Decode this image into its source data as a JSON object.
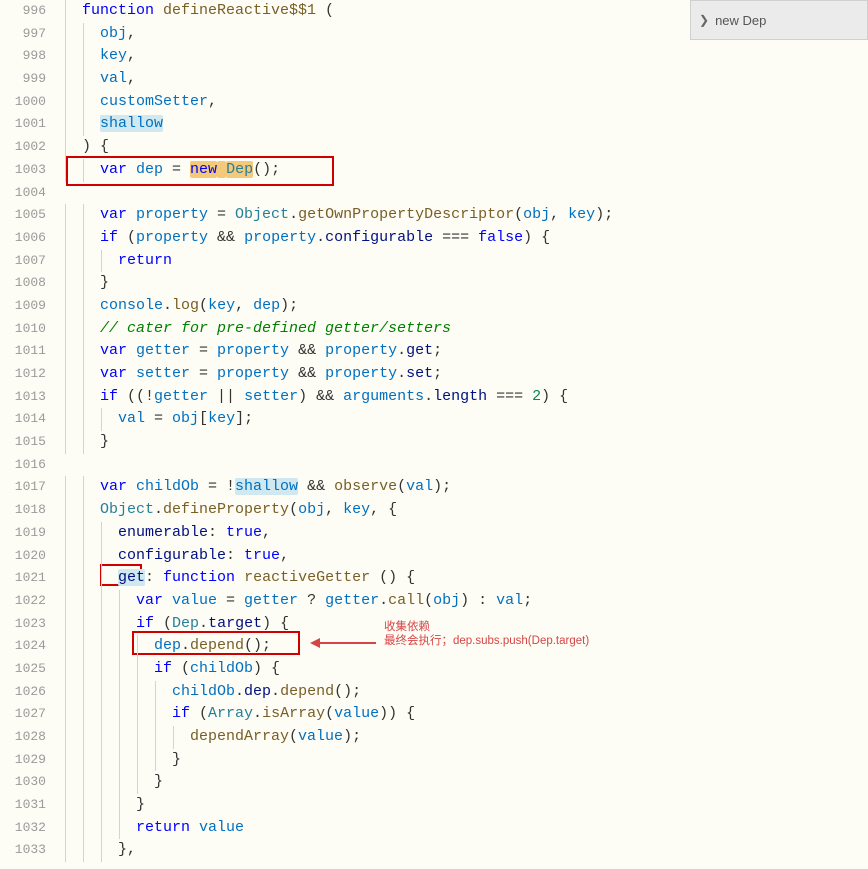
{
  "outline": {
    "label": "new Dep"
  },
  "annotation": {
    "line1": "收集依赖",
    "line2": "最终会执行；dep.subs.push(Dep.target)"
  },
  "lines": [
    {
      "num": 996,
      "ind": 1,
      "tokens": [
        {
          "t": "function ",
          "c": "k-blue"
        },
        {
          "t": "defineReactive$$1",
          "c": "k-call"
        },
        {
          "t": " (",
          "c": ""
        }
      ]
    },
    {
      "num": 997,
      "ind": 2,
      "tokens": [
        {
          "t": "obj",
          "c": "k-var"
        },
        {
          "t": ",",
          "c": ""
        }
      ]
    },
    {
      "num": 998,
      "ind": 2,
      "tokens": [
        {
          "t": "key",
          "c": "k-var"
        },
        {
          "t": ",",
          "c": ""
        }
      ]
    },
    {
      "num": 999,
      "ind": 2,
      "tokens": [
        {
          "t": "val",
          "c": "k-var"
        },
        {
          "t": ",",
          "c": ""
        }
      ]
    },
    {
      "num": 1000,
      "ind": 2,
      "tokens": [
        {
          "t": "customSetter",
          "c": "k-var"
        },
        {
          "t": ",",
          "c": ""
        }
      ]
    },
    {
      "num": 1001,
      "ind": 2,
      "tokens": [
        {
          "t": "shallow",
          "c": "k-var",
          "hl": "hl-shallow"
        }
      ]
    },
    {
      "num": 1002,
      "ind": 1,
      "tokens": [
        {
          "t": ") {",
          "c": ""
        }
      ]
    },
    {
      "num": 1003,
      "ind": 2,
      "tokens": [
        {
          "t": "var ",
          "c": "k-blue"
        },
        {
          "t": "dep",
          "c": "k-var"
        },
        {
          "t": " = ",
          "c": ""
        },
        {
          "t": "new",
          "c": "k-blue",
          "hl": "hl-newdep"
        },
        {
          "t": " ",
          "c": "",
          "hl": "hl-newdep"
        },
        {
          "t": "Dep",
          "c": "k-func",
          "hl": "hl-newdep"
        },
        {
          "t": "();",
          "c": ""
        }
      ]
    },
    {
      "num": 1004,
      "ind": 0,
      "tokens": []
    },
    {
      "num": 1005,
      "ind": 2,
      "tokens": [
        {
          "t": "var ",
          "c": "k-blue"
        },
        {
          "t": "property",
          "c": "k-var"
        },
        {
          "t": " = ",
          "c": ""
        },
        {
          "t": "Object",
          "c": "k-func"
        },
        {
          "t": ".",
          "c": ""
        },
        {
          "t": "getOwnPropertyDescriptor",
          "c": "k-call"
        },
        {
          "t": "(",
          "c": ""
        },
        {
          "t": "obj",
          "c": "k-var"
        },
        {
          "t": ", ",
          "c": ""
        },
        {
          "t": "key",
          "c": "k-var"
        },
        {
          "t": ");",
          "c": ""
        }
      ]
    },
    {
      "num": 1006,
      "ind": 2,
      "tokens": [
        {
          "t": "if",
          "c": "k-blue"
        },
        {
          "t": " (",
          "c": ""
        },
        {
          "t": "property",
          "c": "k-var"
        },
        {
          "t": " && ",
          "c": ""
        },
        {
          "t": "property",
          "c": "k-var"
        },
        {
          "t": ".",
          "c": ""
        },
        {
          "t": "configurable",
          "c": "k-prop"
        },
        {
          "t": " === ",
          "c": ""
        },
        {
          "t": "false",
          "c": "k-const"
        },
        {
          "t": ") {",
          "c": ""
        }
      ]
    },
    {
      "num": 1007,
      "ind": 3,
      "tokens": [
        {
          "t": "return",
          "c": "k-blue"
        }
      ]
    },
    {
      "num": 1008,
      "ind": 2,
      "tokens": [
        {
          "t": "}",
          "c": ""
        }
      ]
    },
    {
      "num": 1009,
      "ind": 2,
      "tokens": [
        {
          "t": "console",
          "c": "k-var"
        },
        {
          "t": ".",
          "c": ""
        },
        {
          "t": "log",
          "c": "k-call"
        },
        {
          "t": "(",
          "c": ""
        },
        {
          "t": "key",
          "c": "k-var"
        },
        {
          "t": ", ",
          "c": ""
        },
        {
          "t": "dep",
          "c": "k-var"
        },
        {
          "t": ");",
          "c": ""
        }
      ]
    },
    {
      "num": 1010,
      "ind": 2,
      "tokens": [
        {
          "t": "// cater for pre-defined getter/setters",
          "c": "k-comment"
        }
      ]
    },
    {
      "num": 1011,
      "ind": 2,
      "tokens": [
        {
          "t": "var ",
          "c": "k-blue"
        },
        {
          "t": "getter",
          "c": "k-var"
        },
        {
          "t": " = ",
          "c": ""
        },
        {
          "t": "property",
          "c": "k-var"
        },
        {
          "t": " && ",
          "c": ""
        },
        {
          "t": "property",
          "c": "k-var"
        },
        {
          "t": ".",
          "c": ""
        },
        {
          "t": "get",
          "c": "k-prop"
        },
        {
          "t": ";",
          "c": ""
        }
      ]
    },
    {
      "num": 1012,
      "ind": 2,
      "tokens": [
        {
          "t": "var ",
          "c": "k-blue"
        },
        {
          "t": "setter",
          "c": "k-var"
        },
        {
          "t": " = ",
          "c": ""
        },
        {
          "t": "property",
          "c": "k-var"
        },
        {
          "t": " && ",
          "c": ""
        },
        {
          "t": "property",
          "c": "k-var"
        },
        {
          "t": ".",
          "c": ""
        },
        {
          "t": "set",
          "c": "k-prop"
        },
        {
          "t": ";",
          "c": ""
        }
      ]
    },
    {
      "num": 1013,
      "ind": 2,
      "tokens": [
        {
          "t": "if",
          "c": "k-blue"
        },
        {
          "t": " ((!",
          "c": ""
        },
        {
          "t": "getter",
          "c": "k-var"
        },
        {
          "t": " || ",
          "c": ""
        },
        {
          "t": "setter",
          "c": "k-var"
        },
        {
          "t": ") && ",
          "c": ""
        },
        {
          "t": "arguments",
          "c": "k-var"
        },
        {
          "t": ".",
          "c": ""
        },
        {
          "t": "length",
          "c": "k-prop"
        },
        {
          "t": " === ",
          "c": ""
        },
        {
          "t": "2",
          "c": "k-num"
        },
        {
          "t": ") {",
          "c": ""
        }
      ]
    },
    {
      "num": 1014,
      "ind": 3,
      "tokens": [
        {
          "t": "val",
          "c": "k-var"
        },
        {
          "t": " = ",
          "c": ""
        },
        {
          "t": "obj",
          "c": "k-var"
        },
        {
          "t": "[",
          "c": ""
        },
        {
          "t": "key",
          "c": "k-var"
        },
        {
          "t": "];",
          "c": ""
        }
      ]
    },
    {
      "num": 1015,
      "ind": 2,
      "tokens": [
        {
          "t": "}",
          "c": ""
        }
      ]
    },
    {
      "num": 1016,
      "ind": 0,
      "tokens": []
    },
    {
      "num": 1017,
      "ind": 2,
      "tokens": [
        {
          "t": "var ",
          "c": "k-blue"
        },
        {
          "t": "childOb",
          "c": "k-var"
        },
        {
          "t": " = !",
          "c": ""
        },
        {
          "t": "shallow",
          "c": "k-var",
          "hl": "hl-shallow"
        },
        {
          "t": " && ",
          "c": ""
        },
        {
          "t": "observe",
          "c": "k-call"
        },
        {
          "t": "(",
          "c": ""
        },
        {
          "t": "val",
          "c": "k-var"
        },
        {
          "t": ");",
          "c": ""
        }
      ]
    },
    {
      "num": 1018,
      "ind": 2,
      "tokens": [
        {
          "t": "Object",
          "c": "k-func"
        },
        {
          "t": ".",
          "c": ""
        },
        {
          "t": "defineProperty",
          "c": "k-call"
        },
        {
          "t": "(",
          "c": ""
        },
        {
          "t": "obj",
          "c": "k-var"
        },
        {
          "t": ", ",
          "c": ""
        },
        {
          "t": "key",
          "c": "k-var"
        },
        {
          "t": ", {",
          "c": ""
        }
      ]
    },
    {
      "num": 1019,
      "ind": 3,
      "tokens": [
        {
          "t": "enumerable",
          "c": "k-prop"
        },
        {
          "t": ": ",
          "c": ""
        },
        {
          "t": "true",
          "c": "k-const"
        },
        {
          "t": ",",
          "c": ""
        }
      ]
    },
    {
      "num": 1020,
      "ind": 3,
      "tokens": [
        {
          "t": "configurable",
          "c": "k-prop"
        },
        {
          "t": ": ",
          "c": ""
        },
        {
          "t": "true",
          "c": "k-const"
        },
        {
          "t": ",",
          "c": ""
        }
      ]
    },
    {
      "num": 1021,
      "ind": 3,
      "tokens": [
        {
          "t": "get",
          "c": "k-prop",
          "hl": "hl-get"
        },
        {
          "t": ":",
          "c": ""
        },
        {
          "t": " ",
          "c": ""
        },
        {
          "t": "function ",
          "c": "k-blue"
        },
        {
          "t": "reactiveGetter",
          "c": "k-call"
        },
        {
          "t": " () {",
          "c": ""
        }
      ]
    },
    {
      "num": 1022,
      "ind": 4,
      "tokens": [
        {
          "t": "var ",
          "c": "k-blue"
        },
        {
          "t": "value",
          "c": "k-var"
        },
        {
          "t": " = ",
          "c": ""
        },
        {
          "t": "getter",
          "c": "k-var"
        },
        {
          "t": " ? ",
          "c": ""
        },
        {
          "t": "getter",
          "c": "k-var"
        },
        {
          "t": ".",
          "c": ""
        },
        {
          "t": "call",
          "c": "k-call"
        },
        {
          "t": "(",
          "c": ""
        },
        {
          "t": "obj",
          "c": "k-var"
        },
        {
          "t": ") : ",
          "c": ""
        },
        {
          "t": "val",
          "c": "k-var"
        },
        {
          "t": ";",
          "c": ""
        }
      ]
    },
    {
      "num": 1023,
      "ind": 4,
      "tokens": [
        {
          "t": "if",
          "c": "k-blue"
        },
        {
          "t": " (",
          "c": ""
        },
        {
          "t": "Dep",
          "c": "k-func"
        },
        {
          "t": ".",
          "c": ""
        },
        {
          "t": "target",
          "c": "k-prop"
        },
        {
          "t": ") {",
          "c": ""
        }
      ]
    },
    {
      "num": 1024,
      "ind": 5,
      "tokens": [
        {
          "t": "dep",
          "c": "k-var"
        },
        {
          "t": ".",
          "c": ""
        },
        {
          "t": "depend",
          "c": "k-call"
        },
        {
          "t": "();",
          "c": ""
        }
      ]
    },
    {
      "num": 1025,
      "ind": 5,
      "tokens": [
        {
          "t": "if",
          "c": "k-blue"
        },
        {
          "t": " (",
          "c": ""
        },
        {
          "t": "childOb",
          "c": "k-var"
        },
        {
          "t": ") {",
          "c": ""
        }
      ]
    },
    {
      "num": 1026,
      "ind": 6,
      "tokens": [
        {
          "t": "childOb",
          "c": "k-var"
        },
        {
          "t": ".",
          "c": ""
        },
        {
          "t": "dep",
          "c": "k-prop"
        },
        {
          "t": ".",
          "c": ""
        },
        {
          "t": "depend",
          "c": "k-call"
        },
        {
          "t": "();",
          "c": ""
        }
      ]
    },
    {
      "num": 1027,
      "ind": 6,
      "tokens": [
        {
          "t": "if",
          "c": "k-blue"
        },
        {
          "t": " (",
          "c": ""
        },
        {
          "t": "Array",
          "c": "k-func"
        },
        {
          "t": ".",
          "c": ""
        },
        {
          "t": "isArray",
          "c": "k-call"
        },
        {
          "t": "(",
          "c": ""
        },
        {
          "t": "value",
          "c": "k-var"
        },
        {
          "t": ")) {",
          "c": ""
        }
      ]
    },
    {
      "num": 1028,
      "ind": 7,
      "tokens": [
        {
          "t": "dependArray",
          "c": "k-call"
        },
        {
          "t": "(",
          "c": ""
        },
        {
          "t": "value",
          "c": "k-var"
        },
        {
          "t": ");",
          "c": ""
        }
      ]
    },
    {
      "num": 1029,
      "ind": 6,
      "tokens": [
        {
          "t": "}",
          "c": ""
        }
      ]
    },
    {
      "num": 1030,
      "ind": 5,
      "tokens": [
        {
          "t": "}",
          "c": ""
        }
      ]
    },
    {
      "num": 1031,
      "ind": 4,
      "tokens": [
        {
          "t": "}",
          "c": ""
        }
      ]
    },
    {
      "num": 1032,
      "ind": 4,
      "tokens": [
        {
          "t": "return ",
          "c": "k-blue"
        },
        {
          "t": "value",
          "c": "k-var"
        }
      ]
    },
    {
      "num": 1033,
      "ind": 3,
      "tokens": [
        {
          "t": "},",
          "c": ""
        }
      ]
    }
  ]
}
